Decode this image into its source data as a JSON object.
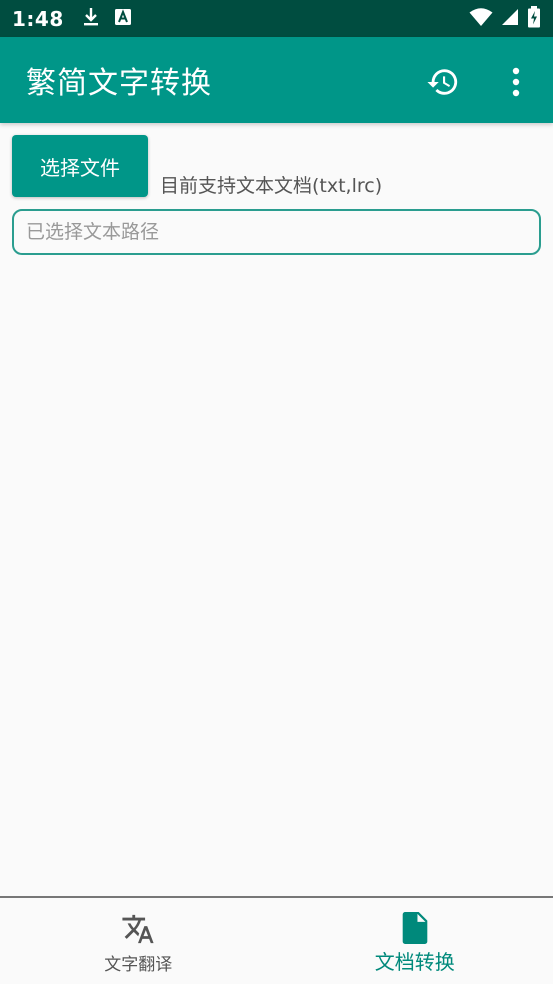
{
  "status_bar": {
    "time": "1:48",
    "icons": [
      "download-icon",
      "app-a-icon",
      "wifi-icon",
      "signal-icon",
      "battery-charging-icon"
    ]
  },
  "app_bar": {
    "title": "繁简文字转换",
    "actions": [
      "history-icon",
      "more-vert-icon"
    ]
  },
  "content": {
    "select_button_label": "选择文件",
    "support_text": "目前支持文本文档(txt,lrc)",
    "path_input": {
      "value": "",
      "placeholder": "已选择文本路径"
    }
  },
  "bottom_nav": {
    "items": [
      {
        "label": "文字翻译",
        "icon": "translate-icon",
        "active": false
      },
      {
        "label": "文档转换",
        "icon": "document-icon",
        "active": true
      }
    ]
  },
  "colors": {
    "status_bar": "#004d40",
    "primary": "#009688",
    "accent_text": "#00897b",
    "background": "#fafafa"
  }
}
